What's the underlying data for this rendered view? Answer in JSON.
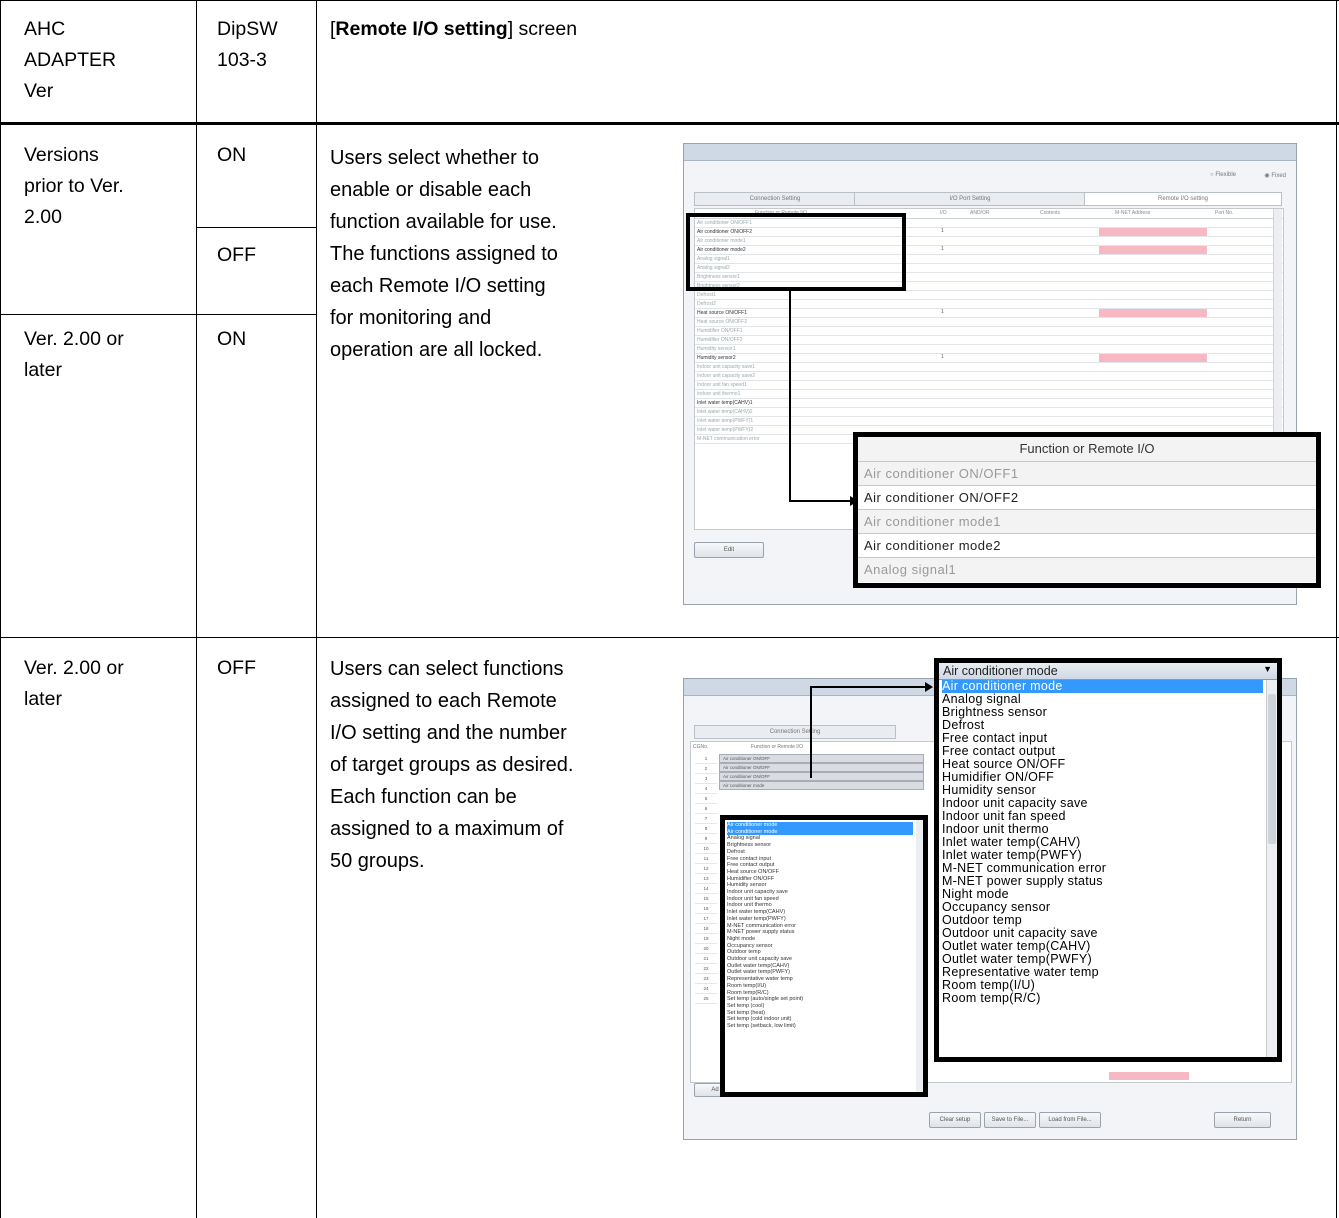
{
  "header": {
    "col1": [
      "AHC",
      "ADAPTER",
      "Ver"
    ],
    "col2": [
      "DipSW",
      "103-3"
    ],
    "col3_prefix": "[",
    "col3_bold": "Remote I/O setting",
    "col3_suffix": "] screen"
  },
  "rows": [
    {
      "version_lines": [
        "Versions",
        "prior to Ver.",
        "2.00"
      ],
      "switch": "ON"
    },
    {
      "switch": "OFF"
    },
    {
      "version_lines": [
        "Ver. 2.00 or",
        "later"
      ],
      "switch": "ON",
      "description_lines": [
        "Users select whether to",
        "enable or disable each",
        "function available for use.",
        "The functions assigned to",
        "each Remote I/O setting",
        "for monitoring and",
        "operation are all locked."
      ]
    },
    {
      "version_lines": [
        "Ver. 2.00 or",
        "later"
      ],
      "switch": "OFF",
      "description_lines": [
        "Users can select functions",
        "assigned to each Remote",
        "I/O setting and the number",
        "of target groups as desired.",
        "Each function can be",
        "assigned to a maximum of",
        "50 groups."
      ]
    }
  ],
  "screenshot1": {
    "tabs": [
      "Connection Setting",
      "I/O Port Setting",
      "Remote I/O setting"
    ],
    "radio_labels": [
      "Flexible",
      "Fixed"
    ],
    "columns": [
      "Function or Remote I/O",
      "I/O",
      "AND/OR",
      "Contents",
      "M-NET Address",
      "Port No."
    ],
    "rows": [
      "Air conditioner ON/OFF1",
      "Air conditioner ON/OFF2",
      "Air conditioner mode1",
      "Air conditioner mode2",
      "Analog signal1",
      "Analog signal2",
      "Brightness sensor1",
      "Brightness sensor2",
      "Defrost1",
      "Defrost2",
      "Heat source ON/OFF1",
      "Heat source ON/OFF2",
      "Humidifier ON/OFF1",
      "Humidifier ON/OFF2",
      "Humidity sensor1",
      "Humidity sensor2",
      "Indoor unit capacity save1",
      "Indoor unit capacity save2",
      "Indoor unit fan speed1",
      "Indoor unit thermo1",
      "Inlet water temp(CAHV)1",
      "Inlet water temp(CAHV)2",
      "Inlet water temp(PWFY)1",
      "Inlet water temp(PWFY)2",
      "M-NET communication error"
    ],
    "io_marks": [
      "1",
      "1",
      "1",
      "1"
    ],
    "edit_button": "Edit",
    "zoom_header": "Function or Remote I/O",
    "zoom_rows": [
      "Air conditioner ON/OFF1",
      "Air conditioner ON/OFF2",
      "Air conditioner mode1",
      "Air conditioner mode2",
      "Analog signal1"
    ]
  },
  "screenshot2": {
    "tab": "Connection Setting",
    "col_headers": [
      "CGNo.",
      "Function or Remote I/O"
    ],
    "group_numbers": [
      "1",
      "2",
      "3",
      "4",
      "5",
      "6",
      "7",
      "8",
      "9",
      "10",
      "11",
      "12",
      "13",
      "14",
      "15",
      "16",
      "17",
      "18",
      "19",
      "20",
      "21",
      "22",
      "23",
      "24",
      "25"
    ],
    "small_selects": [
      "Air conditioner ON/OFF",
      "Air conditioner ON/OFF",
      "Air conditioner ON/OFF",
      "Air conditioner mode"
    ],
    "small_list": [
      "Air conditioner mode",
      "Air conditioner mode",
      "Analog signal",
      "Brightness sensor",
      "Defrost",
      "Free contact input",
      "Free contact output",
      "Heat source ON/OFF",
      "Humidifier ON/OFF",
      "Humidity sensor",
      "Indoor unit capacity save",
      "Indoor unit fan speed",
      "Indoor unit thermo",
      "Inlet water temp(CAHV)",
      "Inlet water temp(PWFY)",
      "M-NET communication error",
      "M-NET power supply status",
      "Night mode",
      "Occupancy sensor",
      "Outdoor temp",
      "Outdoor unit capacity save",
      "Outlet water temp(CAHV)",
      "Outlet water temp(PWFY)",
      "Representative water temp",
      "Room temp(I/U)",
      "Room temp(R/C)",
      "Set temp (auto/single set point)",
      "Set temp (cool)",
      "Set temp (heat)",
      "Set temp (cold indoor unit)",
      "Set temp (setback, low limit)"
    ],
    "buttons": [
      "Clear setup",
      "Save to File...",
      "Load from File...",
      "Return"
    ],
    "add_button": "Ad",
    "zoom_select": "Air conditioner mode",
    "zoom_list": [
      "Air conditioner mode",
      "Analog signal",
      "Brightness sensor",
      "Defrost",
      "Free contact input",
      "Free contact output",
      "Heat source ON/OFF",
      "Humidifier ON/OFF",
      "Humidity sensor",
      "Indoor unit capacity save",
      "Indoor unit fan speed",
      "Indoor unit thermo",
      "Inlet water temp(CAHV)",
      "Inlet water temp(PWFY)",
      "M-NET communication error",
      "M-NET power supply status",
      "Night mode",
      "Occupancy sensor",
      "Outdoor temp",
      "Outdoor unit capacity save",
      "Outlet water temp(CAHV)",
      "Outlet water temp(PWFY)",
      "Representative water temp",
      "Room temp(I/U)",
      "Room temp(R/C)"
    ]
  },
  "colors": {
    "border": "#000000",
    "highlight": "#3399ff",
    "pink": "#f6b8c3"
  }
}
